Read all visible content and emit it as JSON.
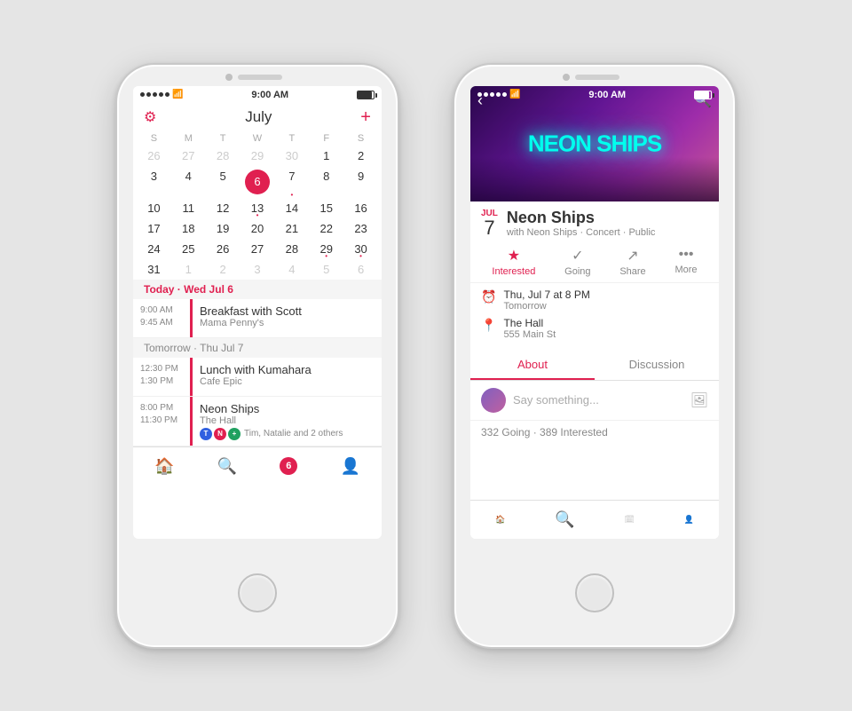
{
  "scene": {
    "bg": "#e5e5e5"
  },
  "phone1": {
    "status": {
      "time": "9:00 AM",
      "signal_dots": 5,
      "wifi": true,
      "battery": "full"
    },
    "calendar": {
      "month": "July",
      "days_labels": [
        "S",
        "M",
        "T",
        "W",
        "T",
        "F",
        "S"
      ],
      "weeks": [
        [
          {
            "num": "26",
            "type": "other"
          },
          {
            "num": "27",
            "type": "other"
          },
          {
            "num": "28",
            "type": "other"
          },
          {
            "num": "29",
            "type": "other"
          },
          {
            "num": "30",
            "type": "other"
          },
          {
            "num": "1",
            "type": "normal"
          },
          {
            "num": "2",
            "type": "normal"
          }
        ],
        [
          {
            "num": "3",
            "type": "normal"
          },
          {
            "num": "4",
            "type": "normal"
          },
          {
            "num": "5",
            "type": "normal"
          },
          {
            "num": "6",
            "type": "today"
          },
          {
            "num": "7",
            "type": "dot"
          },
          {
            "num": "8",
            "type": "normal"
          },
          {
            "num": "9",
            "type": "normal"
          }
        ],
        [
          {
            "num": "10",
            "type": "normal"
          },
          {
            "num": "11",
            "type": "normal"
          },
          {
            "num": "12",
            "type": "normal"
          },
          {
            "num": "13",
            "type": "dot"
          },
          {
            "num": "14",
            "type": "normal"
          },
          {
            "num": "15",
            "type": "normal"
          },
          {
            "num": "16",
            "type": "normal"
          }
        ],
        [
          {
            "num": "17",
            "type": "normal"
          },
          {
            "num": "18",
            "type": "normal"
          },
          {
            "num": "19",
            "type": "normal"
          },
          {
            "num": "20",
            "type": "normal"
          },
          {
            "num": "21",
            "type": "normal"
          },
          {
            "num": "22",
            "type": "normal"
          },
          {
            "num": "23",
            "type": "normal"
          }
        ],
        [
          {
            "num": "24",
            "type": "normal"
          },
          {
            "num": "25",
            "type": "normal"
          },
          {
            "num": "26",
            "type": "normal"
          },
          {
            "num": "27",
            "type": "normal"
          },
          {
            "num": "28",
            "type": "normal"
          },
          {
            "num": "29",
            "type": "dot"
          },
          {
            "num": "30",
            "type": "dot"
          }
        ],
        [
          {
            "num": "31",
            "type": "normal"
          },
          {
            "num": "1",
            "type": "other"
          },
          {
            "num": "2",
            "type": "other"
          },
          {
            "num": "3",
            "type": "other"
          },
          {
            "num": "4",
            "type": "other"
          },
          {
            "num": "5",
            "type": "other"
          },
          {
            "num": "6",
            "type": "other"
          }
        ]
      ],
      "section_today": "Today · Wed Jul 6",
      "section_tomorrow": "Tomorrow · Thu Jul 7",
      "events": [
        {
          "time_start": "9:00 AM",
          "time_end": "9:45 AM",
          "title": "Breakfast with Scott",
          "subtitle": "Mama Penny's",
          "has_avatars": false
        },
        {
          "time_start": "12:30 PM",
          "time_end": "1:30 PM",
          "title": "Lunch with Kumahara",
          "subtitle": "Cafe Epic",
          "has_avatars": false
        },
        {
          "time_start": "8:00 PM",
          "time_end": "11:30 PM",
          "title": "Neon Ships",
          "subtitle": "The Hall",
          "has_avatars": true,
          "avatar_text": "Tim, Natalie and 2 others"
        }
      ]
    },
    "tabs": [
      {
        "icon": "🏠",
        "label": ""
      },
      {
        "icon": "🔍",
        "label": ""
      },
      {
        "badge": "6",
        "label": ""
      },
      {
        "icon": "👤",
        "label": ""
      }
    ]
  },
  "phone2": {
    "status": {
      "time": "9:00 AM"
    },
    "event": {
      "hero_text": "NEON SHIPS",
      "date_month": "JUL",
      "date_day": "7",
      "title": "Neon Ships",
      "subtitle": "with Neon Ships · Concert · Public",
      "actions": [
        {
          "label": "Interested",
          "icon": "★",
          "active": true
        },
        {
          "label": "Going",
          "icon": "✓",
          "active": false
        },
        {
          "label": "Share",
          "icon": "↗",
          "active": false
        },
        {
          "label": "More",
          "icon": "•••",
          "active": false
        }
      ],
      "when": "Thu, Jul 7 at 8 PM",
      "when_sub": "Tomorrow",
      "where": "The Hall",
      "where_sub": "555 Main St",
      "tabs": [
        {
          "label": "About",
          "active": true
        },
        {
          "label": "Discussion",
          "active": false
        }
      ],
      "comment_placeholder": "Say something...",
      "stats": "332 Going · 389 Interested"
    },
    "tabs": [
      {
        "icon": "🏠",
        "label": ""
      },
      {
        "icon": "🔍",
        "label": "",
        "active": true
      },
      {
        "icon": "🗓",
        "label": ""
      },
      {
        "icon": "👤",
        "label": ""
      }
    ]
  }
}
